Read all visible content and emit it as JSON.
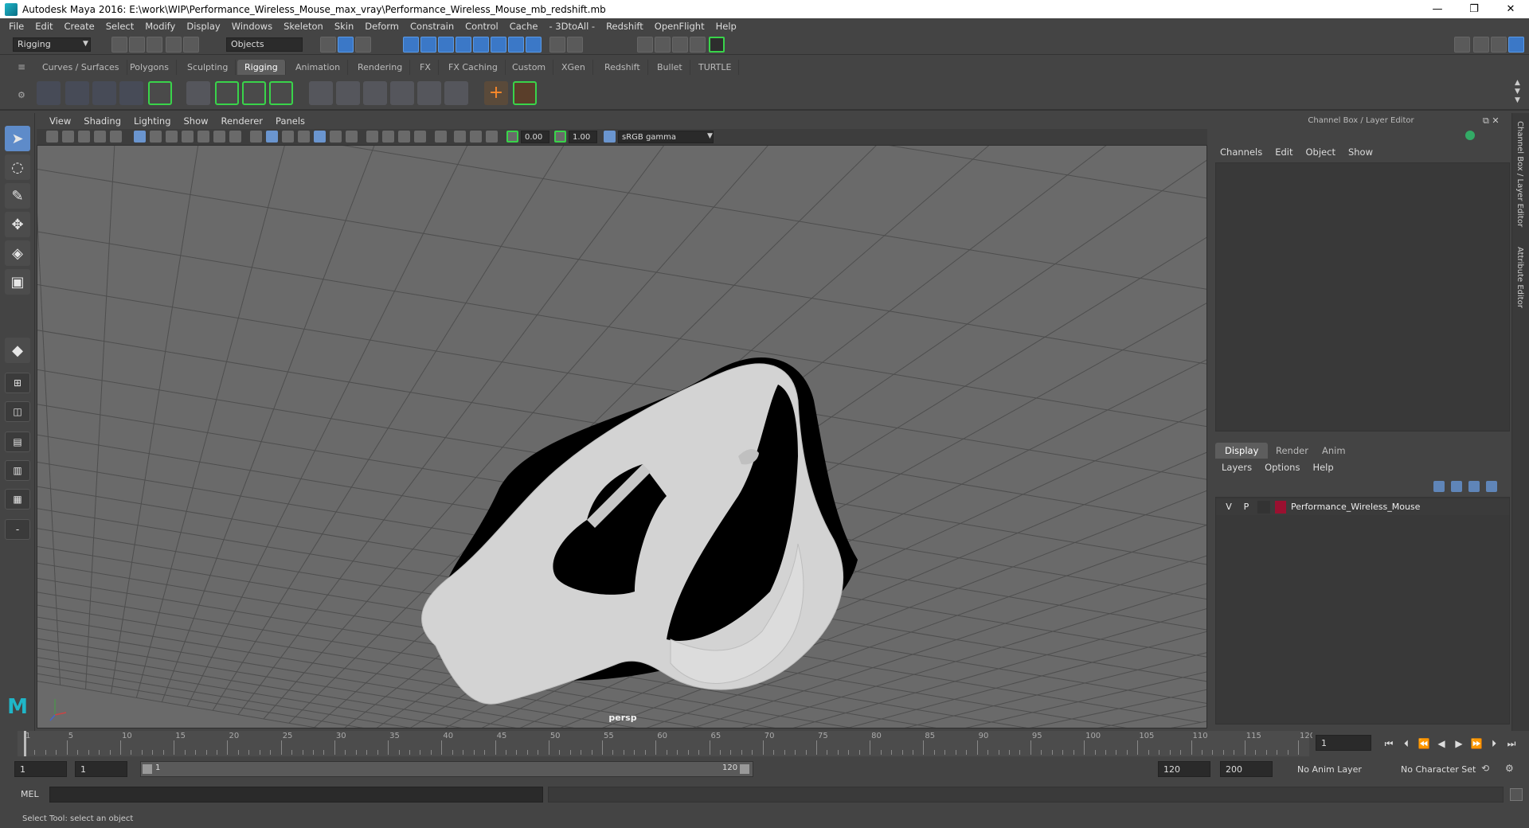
{
  "window": {
    "title": "Autodesk Maya 2016: E:\\work\\WIP\\Performance_Wireless_Mouse_max_vray\\Performance_Wireless_Mouse_mb_redshift.mb",
    "minimize": "—",
    "restore": "❐",
    "close": "✕"
  },
  "menu": [
    "File",
    "Edit",
    "Create",
    "Select",
    "Modify",
    "Display",
    "Windows",
    "Skeleton",
    "Skin",
    "Deform",
    "Constrain",
    "Control",
    "Cache",
    "- 3DtoAll -",
    "Redshift",
    "OpenFlight",
    "Help"
  ],
  "status": {
    "mode": "Rigging",
    "select_mode": "Objects"
  },
  "shelf_tabs": [
    "Curves / Surfaces",
    "Polygons",
    "Sculpting",
    "Rigging",
    "Animation",
    "Rendering",
    "FX",
    "FX Caching",
    "Custom",
    "XGen",
    "Redshift",
    "Bullet",
    "TURTLE"
  ],
  "active_shelf_tab": "Rigging",
  "panel_menu": [
    "View",
    "Shading",
    "Lighting",
    "Show",
    "Renderer",
    "Panels"
  ],
  "panel_toolbar": {
    "exposure": "0.00",
    "gamma": "1.00",
    "color_space": "sRGB gamma"
  },
  "viewport": {
    "camera_label": "persp",
    "background": "#6a6a6a",
    "grid_color": "#4a4a4a"
  },
  "channel_box": {
    "title": "Channel Box / Layer Editor",
    "menu": [
      "Channels",
      "Edit",
      "Object",
      "Show"
    ]
  },
  "layer_editor": {
    "tabs": [
      "Display",
      "Render",
      "Anim"
    ],
    "active_tab": "Display",
    "menu": [
      "Layers",
      "Options",
      "Help"
    ],
    "layers": [
      {
        "visible": "V",
        "playback": "P",
        "name": "Performance_Wireless_Mouse",
        "color": "#9a1030"
      }
    ]
  },
  "side_labels": [
    "Channel Box / Layer Editor",
    "Attribute Editor"
  ],
  "timeline": {
    "ticks": [
      "1",
      "5",
      "10",
      "15",
      "20",
      "25",
      "30",
      "35",
      "40",
      "45",
      "50",
      "55",
      "60",
      "65",
      "70",
      "75",
      "80",
      "85",
      "90",
      "95",
      "100",
      "105",
      "110",
      "115",
      "120"
    ],
    "current_frame": "1"
  },
  "range": {
    "start": "1",
    "playback_start": "1",
    "slider_start": "1",
    "slider_end": "120",
    "playback_end": "120",
    "end": "200",
    "anim_layer": "No Anim Layer",
    "character_set": "No Character Set"
  },
  "command": {
    "language": "MEL"
  },
  "help_line": "Select Tool: select an object"
}
